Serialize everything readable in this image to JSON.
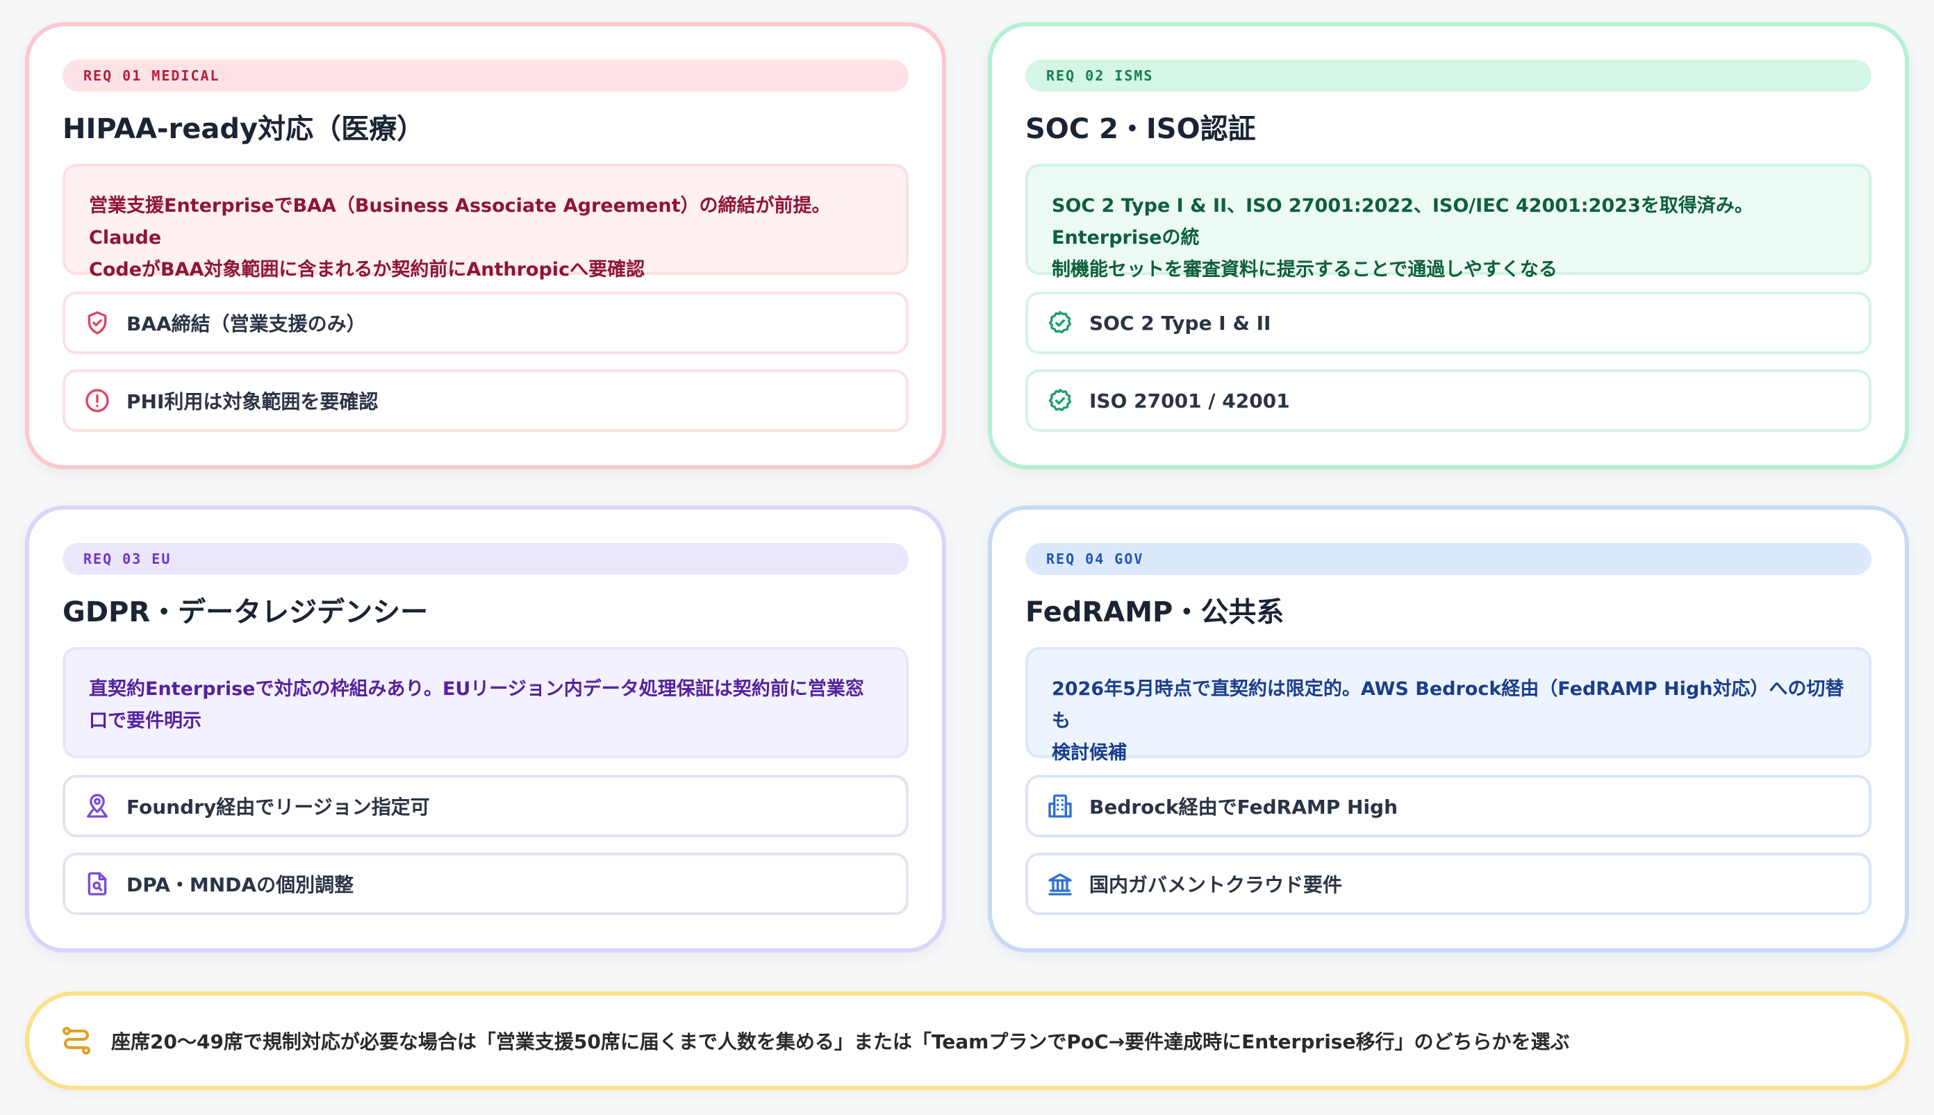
{
  "cards": [
    {
      "tag": "REQ 01 MEDICAL",
      "title": "HIPAA-ready対応（医療）",
      "desc_line1": "営業支援EnterpriseでBAA（Business Associate Agreement）の締結が前提。Claude",
      "desc_line2": "CodeがBAA対象範囲に含まれるか契約前にAnthropicへ要確認",
      "items": [
        {
          "label": "BAA締結（営業支援のみ）",
          "icon": "shield-check-icon"
        },
        {
          "label": "PHI利用は対象範囲を要確認",
          "icon": "alert-circle-icon"
        }
      ],
      "accent": "#e0435f"
    },
    {
      "tag": "REQ 02 ISMS",
      "title": "SOC 2・ISO認証",
      "desc_line1": "SOC 2 Type I & II、ISO 27001:2022、ISO/IEC 42001:2023を取得済み。Enterpriseの統",
      "desc_line2": "制機能セットを審査資料に提示することで通過しやすくなる",
      "items": [
        {
          "label": "SOC 2 Type I & II",
          "icon": "badge-check-icon"
        },
        {
          "label": "ISO 27001 / 42001",
          "icon": "badge-check-icon"
        }
      ],
      "accent": "#1aa06a"
    },
    {
      "tag": "REQ 03 EU",
      "title": "GDPR・データレジデンシー",
      "desc_line1": "直契約Enterpriseで対応の枠組みあり。EUリージョン内データ処理保証は契約前に営業窓",
      "desc_line2": "口で要件明示",
      "items": [
        {
          "label": "Foundry経由でリージョン指定可",
          "icon": "map-pin-icon"
        },
        {
          "label": "DPA・MNDAの個別調整",
          "icon": "file-search-icon"
        }
      ],
      "accent": "#7c4bd6"
    },
    {
      "tag": "REQ 04 GOV",
      "title": "FedRAMP・公共系",
      "desc_line1": "2026年5月時点で直契約は限定的。AWS Bedrock経由（FedRAMP High対応）への切替も",
      "desc_line2": "検討候補",
      "items": [
        {
          "label": "Bedrock経由でFedRAMP High",
          "icon": "building-icon"
        },
        {
          "label": "国内ガバメントクラウド要件",
          "icon": "landmark-icon"
        }
      ],
      "accent": "#2f6fd6"
    }
  ],
  "footer": {
    "text": "座席20〜49席で規制対応が必要な場合は「営業支援50席に届くまで人数を集める」または「TeamプランでPoC→要件達成時にEnterprise移行」のどちらかを選ぶ",
    "icon": "route-icon",
    "accent": "#e0a020"
  }
}
